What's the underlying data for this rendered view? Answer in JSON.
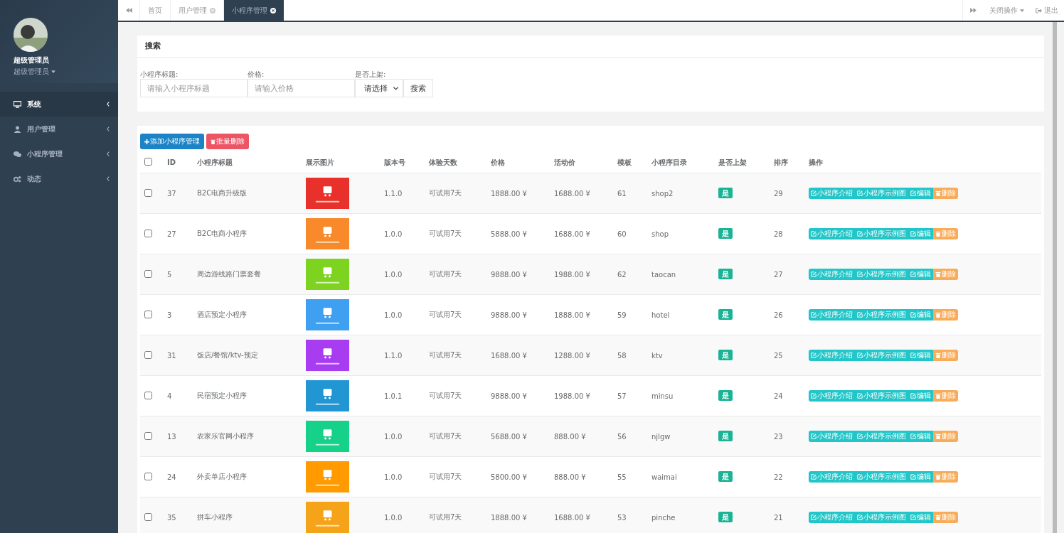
{
  "sidebar": {
    "user": {
      "name": "超级管理员",
      "role": "超级管理员"
    },
    "items": [
      {
        "label": "系统",
        "kind": "monitor",
        "selected": true
      },
      {
        "label": "用户管理",
        "kind": "user",
        "selected": false
      },
      {
        "label": "小程序管理",
        "kind": "chat",
        "selected": false
      },
      {
        "label": "动态",
        "kind": "gears",
        "selected": false
      }
    ]
  },
  "tabs": [
    {
      "label": "首页",
      "closable": false,
      "selected": false
    },
    {
      "label": "用户管理",
      "closable": true,
      "selected": false
    },
    {
      "label": "小程序管理",
      "closable": true,
      "selected": true
    }
  ],
  "top_actions": {
    "close_menu": "关闭操作",
    "logout": "退出"
  },
  "search": {
    "title": "搜索",
    "fields": [
      {
        "kind": "input",
        "label": "小程序标题:",
        "placeholder": "请输入小程序标题"
      },
      {
        "kind": "input",
        "label": "价格:",
        "placeholder": "请输入价格"
      },
      {
        "kind": "select",
        "label": "是否上架:",
        "value": "请选择"
      }
    ],
    "button": "搜索"
  },
  "toolbar": {
    "add": "添加小程序管理",
    "batch_delete": "批量删除"
  },
  "table": {
    "select_all": {
      "checked": false
    },
    "columns": [
      "ID",
      "小程序标题",
      "展示图片",
      "版本号",
      "体验天数",
      "价格",
      "活动价",
      "模板",
      "小程序目录",
      "是否上架",
      "排序",
      "操作"
    ],
    "rows": [
      {
        "checked": false,
        "id": "37",
        "title": "B2C电商升级版",
        "version": "1.1.0",
        "trial": "可试用7天",
        "price": "1888.00 ¥",
        "sale_price": "1688.00 ¥",
        "template": "61",
        "directory": "shop2",
        "on_shelf": "是",
        "sort": "29",
        "actions": [
          {
            "kind": "edit",
            "label": "小程序介绍"
          },
          {
            "kind": "edit",
            "label": "小程序示例图"
          },
          {
            "kind": "edit",
            "label": "编辑"
          },
          {
            "kind": "delete",
            "label": "删除"
          }
        ]
      },
      {
        "checked": false,
        "id": "27",
        "title": "B2C电商小程序",
        "version": "1.0.0",
        "trial": "可试用7天",
        "price": "5888.00 ¥",
        "sale_price": "1688.00 ¥",
        "template": "60",
        "directory": "shop",
        "on_shelf": "是",
        "sort": "28",
        "actions": [
          {
            "kind": "edit",
            "label": "小程序介绍"
          },
          {
            "kind": "edit",
            "label": "小程序示例图"
          },
          {
            "kind": "edit",
            "label": "编辑"
          },
          {
            "kind": "delete",
            "label": "删除"
          }
        ]
      },
      {
        "checked": false,
        "id": "5",
        "title": "周边游线路门票套餐",
        "version": "1.0.0",
        "trial": "可试用7天",
        "price": "9888.00 ¥",
        "sale_price": "1988.00 ¥",
        "template": "62",
        "directory": "taocan",
        "on_shelf": "是",
        "sort": "27",
        "actions": [
          {
            "kind": "edit",
            "label": "小程序介绍"
          },
          {
            "kind": "edit",
            "label": "小程序示例图"
          },
          {
            "kind": "edit",
            "label": "编辑"
          },
          {
            "kind": "delete",
            "label": "删除"
          }
        ]
      },
      {
        "checked": false,
        "id": "3",
        "title": "酒店预定小程序",
        "version": "1.0.0",
        "trial": "可试用7天",
        "price": "9888.00 ¥",
        "sale_price": "1888.00 ¥",
        "template": "59",
        "directory": "hotel",
        "on_shelf": "是",
        "sort": "26",
        "actions": [
          {
            "kind": "edit",
            "label": "小程序介绍"
          },
          {
            "kind": "edit",
            "label": "小程序示例图"
          },
          {
            "kind": "edit",
            "label": "编辑"
          },
          {
            "kind": "delete",
            "label": "删除"
          }
        ]
      },
      {
        "checked": false,
        "id": "31",
        "title": "饭店/餐馆/ktv-预定",
        "version": "1.1.0",
        "trial": "可试用7天",
        "price": "1688.00 ¥",
        "sale_price": "1288.00 ¥",
        "template": "58",
        "directory": "ktv",
        "on_shelf": "是",
        "sort": "25",
        "actions": [
          {
            "kind": "edit",
            "label": "小程序介绍"
          },
          {
            "kind": "edit",
            "label": "小程序示例图"
          },
          {
            "kind": "edit",
            "label": "编辑"
          },
          {
            "kind": "delete",
            "label": "删除"
          }
        ]
      },
      {
        "checked": false,
        "id": "4",
        "title": "民宿预定小程序",
        "version": "1.0.1",
        "trial": "可试用7天",
        "price": "9888.00 ¥",
        "sale_price": "1988.00 ¥",
        "template": "57",
        "directory": "minsu",
        "on_shelf": "是",
        "sort": "24",
        "actions": [
          {
            "kind": "edit",
            "label": "小程序介绍"
          },
          {
            "kind": "edit",
            "label": "小程序示例图"
          },
          {
            "kind": "edit",
            "label": "编辑"
          },
          {
            "kind": "delete",
            "label": "删除"
          }
        ]
      },
      {
        "checked": false,
        "id": "13",
        "title": "农家乐官网小程序",
        "version": "1.0.0",
        "trial": "可试用7天",
        "price": "5688.00 ¥",
        "sale_price": "888.00 ¥",
        "template": "56",
        "directory": "njlgw",
        "on_shelf": "是",
        "sort": "23",
        "actions": [
          {
            "kind": "edit",
            "label": "小程序介绍"
          },
          {
            "kind": "edit",
            "label": "小程序示例图"
          },
          {
            "kind": "edit",
            "label": "编辑"
          },
          {
            "kind": "delete",
            "label": "删除"
          }
        ]
      },
      {
        "checked": false,
        "id": "24",
        "title": "外卖单店小程序",
        "version": "1.0.0",
        "trial": "可试用7天",
        "price": "5800.00 ¥",
        "sale_price": "888.00 ¥",
        "template": "55",
        "directory": "waimai",
        "on_shelf": "是",
        "sort": "22",
        "actions": [
          {
            "kind": "edit",
            "label": "小程序介绍"
          },
          {
            "kind": "edit",
            "label": "小程序示例图"
          },
          {
            "kind": "edit",
            "label": "编辑"
          },
          {
            "kind": "delete",
            "label": "删除"
          }
        ]
      },
      {
        "checked": false,
        "id": "35",
        "title": "拼车小程序",
        "version": "1.0.0",
        "trial": "可试用7天",
        "price": "1888.00 ¥",
        "sale_price": "1688.00 ¥",
        "template": "53",
        "directory": "pinche",
        "on_shelf": "是",
        "sort": "21",
        "actions": [
          {
            "kind": "edit",
            "label": "小程序介绍"
          },
          {
            "kind": "edit",
            "label": "小程序示例图"
          },
          {
            "kind": "edit",
            "label": "编辑"
          },
          {
            "kind": "delete",
            "label": "删除"
          }
        ]
      }
    ]
  }
}
